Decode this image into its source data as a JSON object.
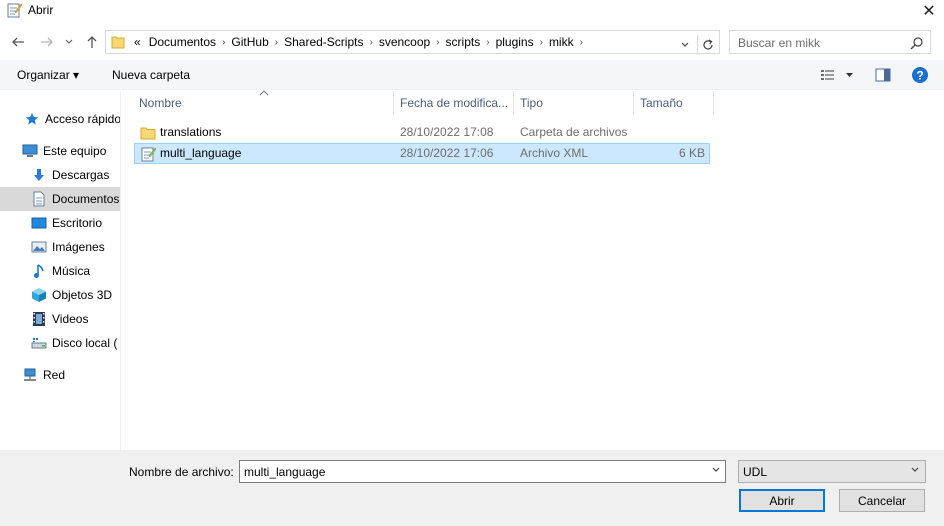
{
  "window": {
    "title": "Abrir",
    "close_label": "✕"
  },
  "nav": {
    "breadcrumb_overflow": "«",
    "breadcrumbs": [
      "Documentos",
      "GitHub",
      "Shared-Scripts",
      "svencoop",
      "scripts",
      "plugins",
      "mikk"
    ],
    "search_placeholder": "Buscar en mikk"
  },
  "toolbar": {
    "organize_label": "Organizar ▾",
    "new_folder_label": "Nueva carpeta",
    "view_icon": "view-grid-icon",
    "pane_icon": "preview-pane-icon",
    "help_label": "?"
  },
  "sidebar": {
    "items": [
      {
        "label": "Acceso rápido",
        "icon": "star-icon"
      },
      {
        "label": "Este equipo",
        "icon": "computer-icon"
      },
      {
        "label": "Descargas",
        "icon": "download-icon"
      },
      {
        "label": "Documentos",
        "icon": "documents-icon"
      },
      {
        "label": "Escritorio",
        "icon": "desktop-icon"
      },
      {
        "label": "Imágenes",
        "icon": "pictures-icon"
      },
      {
        "label": "Música",
        "icon": "music-icon"
      },
      {
        "label": "Objetos 3D",
        "icon": "cube-icon"
      },
      {
        "label": "Videos",
        "icon": "video-icon"
      },
      {
        "label": "Disco local (",
        "icon": "drive-icon"
      },
      {
        "label": "Red",
        "icon": "network-icon"
      }
    ]
  },
  "files": {
    "columns": [
      "Nombre",
      "Fecha de modifica...",
      "Tipo",
      "Tamaño"
    ],
    "rows": [
      {
        "name": "translations",
        "date": "28/10/2022 17:08",
        "type": "Carpeta de archivos",
        "size": "",
        "icon": "folder-icon"
      },
      {
        "name": "multi_language",
        "date": "28/10/2022 17:06",
        "type": "Archivo XML",
        "size": "6 KB",
        "icon": "xml-file-icon"
      }
    ]
  },
  "footer": {
    "filename_label": "Nombre de archivo:",
    "filename_value": "multi_language",
    "filetype_value": "UDL",
    "open_label": "Abrir",
    "cancel_label": "Cancelar"
  },
  "colors": {
    "selection": "#cce8ff",
    "accent": "#0078d7",
    "header_text": "#4c607a"
  }
}
